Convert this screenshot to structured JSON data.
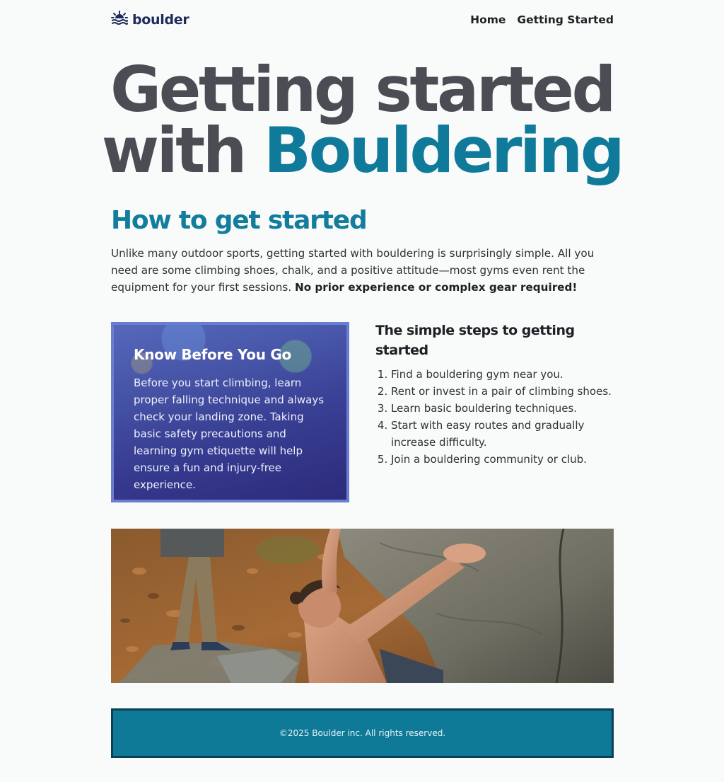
{
  "header": {
    "logo_text": "boulder",
    "nav": [
      {
        "label": "Home"
      },
      {
        "label": "Getting Started"
      }
    ]
  },
  "hero": {
    "line1": "Getting started",
    "line2_prefix": "with",
    "line2_accent": "Bouldering"
  },
  "howto": {
    "heading": "How to get started",
    "paragraph": "Unlike many outdoor sports, getting started with bouldering is surprisingly simple. All you need are some climbing shoes, chalk, and a positive attitude—most gyms even rent the equipment for your first sessions.",
    "emphasis": "No prior experience or complex gear required!"
  },
  "card": {
    "title": "Know Before You Go",
    "body": "Before you start climbing, learn proper falling technique and always check your landing zone. Taking basic safety precautions and learning gym etiquette will help ensure a fun and injury-free experience."
  },
  "steps": {
    "heading": "The simple steps to getting started",
    "items": [
      "Find a bouldering gym near you.",
      "Rent or invest in a pair of climbing shoes.",
      "Learn basic bouldering techniques.",
      "Start with easy routes and gradually increase difficulty.",
      "Join a bouldering community or club."
    ]
  },
  "footer": {
    "copyright": "©2025 Boulder inc. All rights reserved."
  },
  "colors": {
    "accent": "#0f7a9a",
    "heading_gray": "#4a4d54",
    "card_border": "#6b7dd0",
    "footer_bg": "#0e7a98"
  },
  "icons": {
    "logo": "sunrise-icon"
  }
}
